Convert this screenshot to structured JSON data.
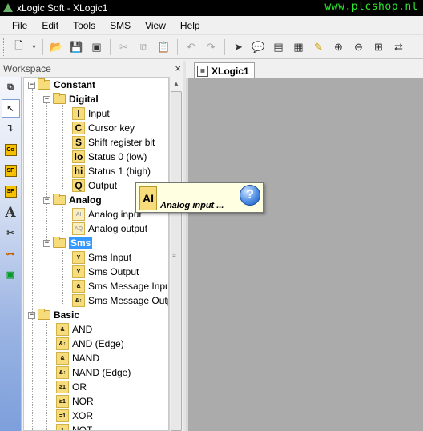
{
  "window": {
    "title": "xLogic Soft - XLogic1",
    "watermark": "www.plcshop.nl"
  },
  "menu": [
    "File",
    "Edit",
    "Tools",
    "SMS",
    "View",
    "Help"
  ],
  "menu_underline": [
    "F",
    "E",
    "T",
    "",
    "V",
    "H"
  ],
  "workspace": {
    "title": "Workspace",
    "close": "×"
  },
  "tree": {
    "constant": "Constant",
    "digital": "Digital",
    "digital_items": [
      {
        "icon": "I",
        "label": "Input"
      },
      {
        "icon": "C",
        "label": "Cursor key"
      },
      {
        "icon": "S",
        "label": "Shift register bit"
      },
      {
        "icon": "lo",
        "label": "Status 0 (low)"
      },
      {
        "icon": "hi",
        "label": "Status 1 (high)"
      },
      {
        "icon": "Q",
        "label": "Output"
      }
    ],
    "analog": "Analog",
    "analog_items": [
      {
        "icon": "AI",
        "label": "Analog input"
      },
      {
        "icon": "AQ",
        "label": "Analog output"
      }
    ],
    "sms": "Sms",
    "sms_items": [
      {
        "icon": "Y",
        "label": "Sms Input"
      },
      {
        "icon": "Y",
        "label": "Sms Output"
      },
      {
        "icon": "&",
        "label": "Sms Message Input"
      },
      {
        "icon": "&↑",
        "label": "Sms Message Outp"
      }
    ],
    "basic": "Basic",
    "basic_items": [
      {
        "icon": "&",
        "label": "AND"
      },
      {
        "icon": "&↑",
        "label": "AND (Edge)"
      },
      {
        "icon": "&",
        "label": "NAND"
      },
      {
        "icon": "&↑",
        "label": "NAND (Edge)"
      },
      {
        "icon": "≥1",
        "label": "OR"
      },
      {
        "icon": "≥1",
        "label": "NOR"
      },
      {
        "icon": "=1",
        "label": "XOR"
      },
      {
        "icon": "1",
        "label": "NOT"
      }
    ]
  },
  "doc_tab": {
    "label": "XLogic1"
  },
  "tooltip": {
    "icon": "AI",
    "text": "Analog input ...",
    "help": "?"
  },
  "left_tools": [
    "Co",
    "SF",
    "SF",
    "A"
  ]
}
